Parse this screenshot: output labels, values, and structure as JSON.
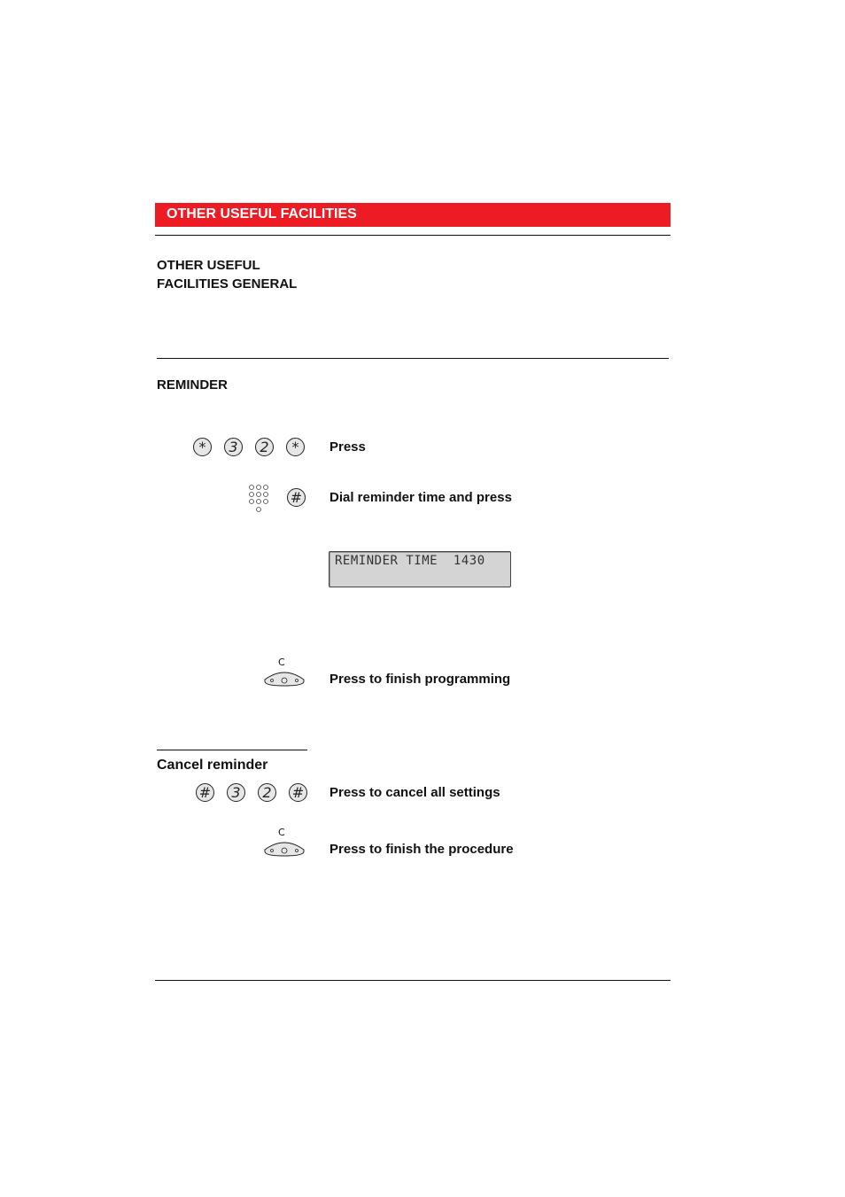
{
  "banner": {
    "title": "OTHER USEFUL FACILITIES",
    "color": "#ed1c24"
  },
  "sections": {
    "general": {
      "heading_line1": "OTHER USEFUL",
      "heading_line2": "FACILITIES GENERAL"
    },
    "reminder": {
      "heading": "REMINDER",
      "steps": [
        {
          "keys": [
            "*",
            "3",
            "2",
            "*"
          ],
          "text": "Press"
        },
        {
          "keys": [
            "keypad",
            "#"
          ],
          "text": "Dial reminder time and press"
        },
        {
          "display": "REMINDER TIME  1430"
        },
        {
          "keys": [
            "C"
          ],
          "text": "Press to finish programming"
        }
      ]
    },
    "cancel": {
      "heading": "Cancel reminder",
      "steps": [
        {
          "keys": [
            "#",
            "3",
            "2",
            "#"
          ],
          "text": "Press to cancel all settings"
        },
        {
          "keys": [
            "C"
          ],
          "text": "Press to finish the procedure"
        }
      ]
    }
  },
  "icons": {
    "clear_key_label": "C"
  }
}
